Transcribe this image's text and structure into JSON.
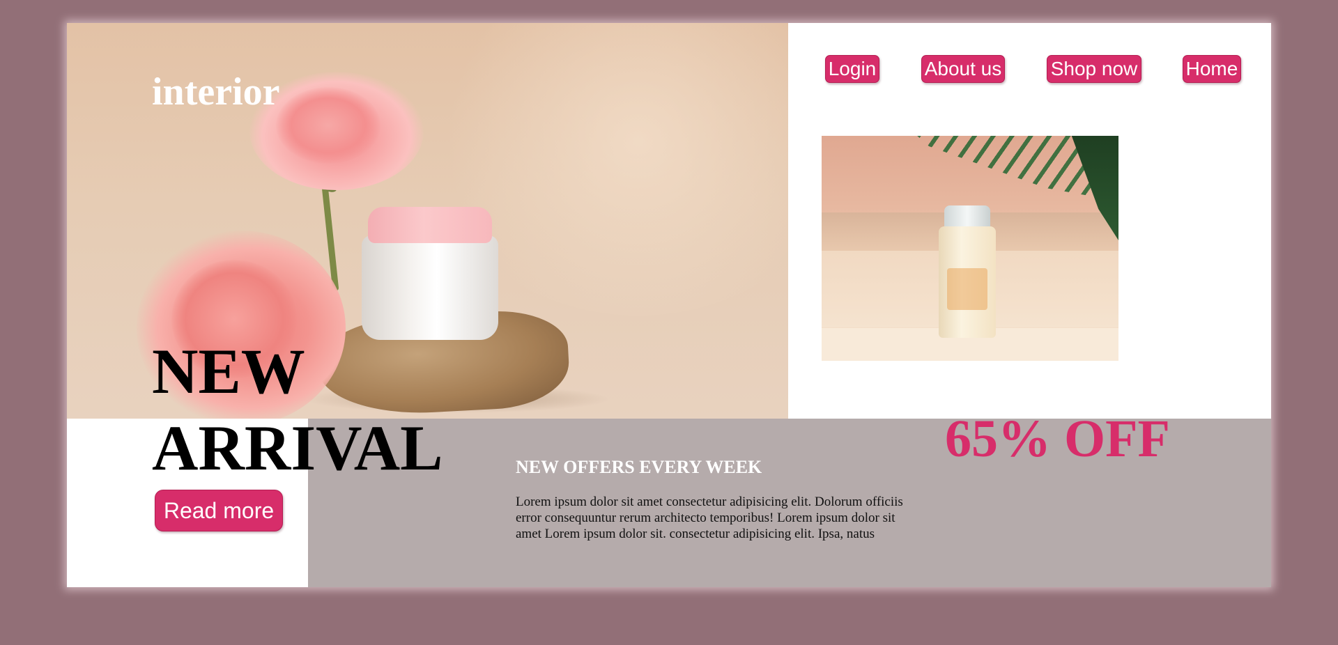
{
  "header": {
    "logo": "interior",
    "nav": {
      "login": "Login",
      "about": "About us",
      "shop": "Shop now",
      "home": "Home"
    }
  },
  "hero": {
    "headline_line1": "NEW",
    "headline_line2": "ARRIVAL",
    "read_more": "Read more",
    "image": "cream-jar-with-roses-on-stone"
  },
  "promo": {
    "discount": "65% OFF",
    "image": "sunscreen-bottle-with-palm-leaf"
  },
  "offers": {
    "title": "NEW OFFERS EVERY WEEK",
    "text": "Lorem ipsum dolor sit amet consectetur adipisicing elit. Dolorum officiis error consequuntur rerum architecto temporibus! Lorem ipsum dolor sit amet Lorem ipsum dolor sit. consectetur adipisicing elit. Ipsa, natus"
  },
  "colors": {
    "page_background": "#926f77",
    "accent": "#d72d6a",
    "offer_band": "#b5abab"
  }
}
